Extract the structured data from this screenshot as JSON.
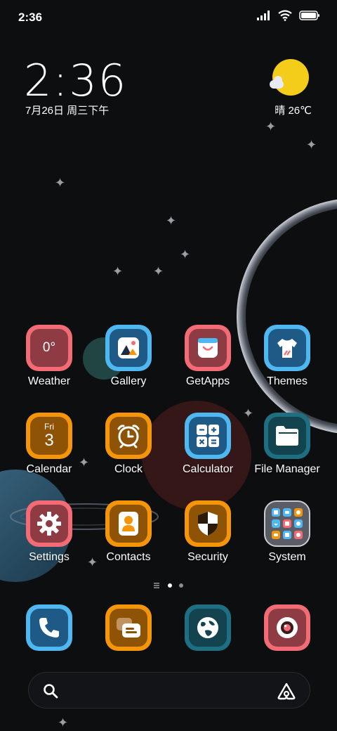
{
  "status_bar": {
    "time": "2:36",
    "icons": [
      "signal-icon",
      "wifi-icon",
      "battery-icon"
    ]
  },
  "clock_widget": {
    "time": "2:36",
    "date": "7月26日 周三下午"
  },
  "weather_widget": {
    "condition": "晴",
    "temperature": "26℃",
    "icon": "sun-cloud-icon"
  },
  "apps": [
    {
      "label": "Weather",
      "icon": "weather-icon",
      "value": "0°",
      "color": "#f26b75"
    },
    {
      "label": "Gallery",
      "icon": "gallery-icon",
      "color": "#4fb8f0"
    },
    {
      "label": "GetApps",
      "icon": "getapps-icon",
      "color": "#f26b75"
    },
    {
      "label": "Themes",
      "icon": "themes-icon",
      "color": "#4fb8f0"
    },
    {
      "label": "Calendar",
      "icon": "calendar-icon",
      "day": "Fri",
      "date": "3",
      "color": "#f5960a"
    },
    {
      "label": "Clock",
      "icon": "clock-icon",
      "color": "#f5960a"
    },
    {
      "label": "Calculator",
      "icon": "calculator-icon",
      "color": "#4fb8f0"
    },
    {
      "label": "File Manager",
      "icon": "file-manager-icon",
      "color": "#1f6f82"
    },
    {
      "label": "Settings",
      "icon": "settings-icon",
      "color": "#f26b75"
    },
    {
      "label": "Contacts",
      "icon": "contacts-icon",
      "color": "#f5960a"
    },
    {
      "label": "Security",
      "icon": "security-icon",
      "color": "#f5960a"
    },
    {
      "label": "System",
      "icon": "folder-icon",
      "color": "#5a5d66"
    }
  ],
  "pager": {
    "pages": 2,
    "active_page": 1,
    "icon": "menu-lines-icon"
  },
  "dock": [
    {
      "icon": "phone-icon",
      "color": "#4fb8f0"
    },
    {
      "icon": "messages-icon",
      "color": "#f5960a"
    },
    {
      "icon": "browser-icon",
      "color": "#1f6f82"
    },
    {
      "icon": "camera-icon",
      "color": "#f26b75"
    }
  ],
  "search_bar": {
    "left_icon": "search-icon",
    "right_icon": "assistant-icon"
  }
}
